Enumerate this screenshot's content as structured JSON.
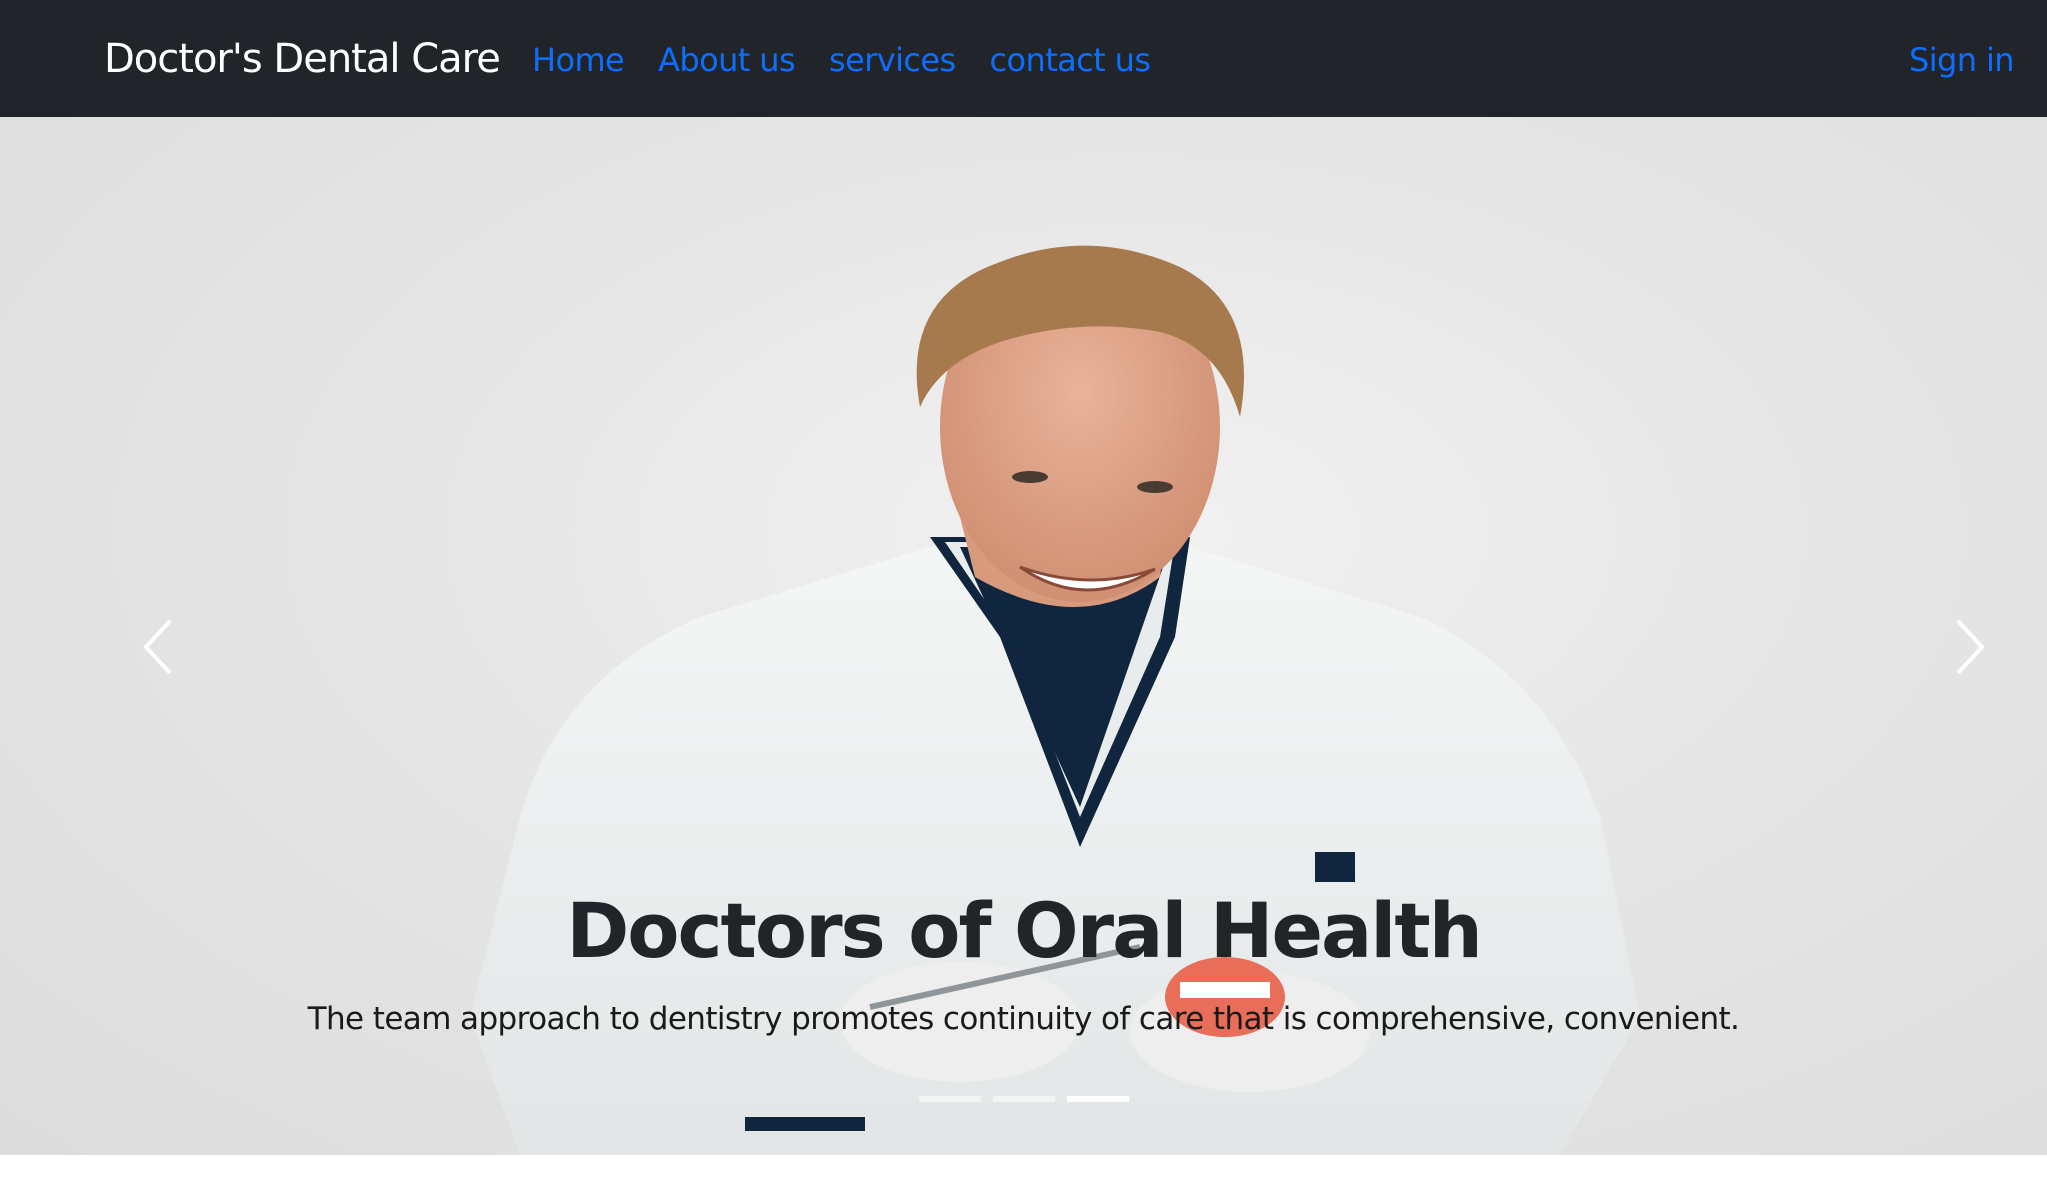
{
  "navbar": {
    "brand": "Doctor's Dental Care",
    "links": [
      {
        "label": "Home"
      },
      {
        "label": "About us"
      },
      {
        "label": "services"
      },
      {
        "label": "contact us"
      }
    ],
    "signin_label": "Sign in"
  },
  "carousel": {
    "title": "Doctors of Oral Health",
    "subtitle": "The team approach to dentistry promotes continuity of care that is comprehensive, convenient.",
    "active_slide": 3,
    "slide_count": 3,
    "prev_icon": "chevron-left-icon",
    "next_icon": "chevron-right-icon"
  },
  "colors": {
    "navbar_bg": "#212529",
    "link": "#0d6efd",
    "brand": "#ffffff",
    "caption": "#212529"
  }
}
